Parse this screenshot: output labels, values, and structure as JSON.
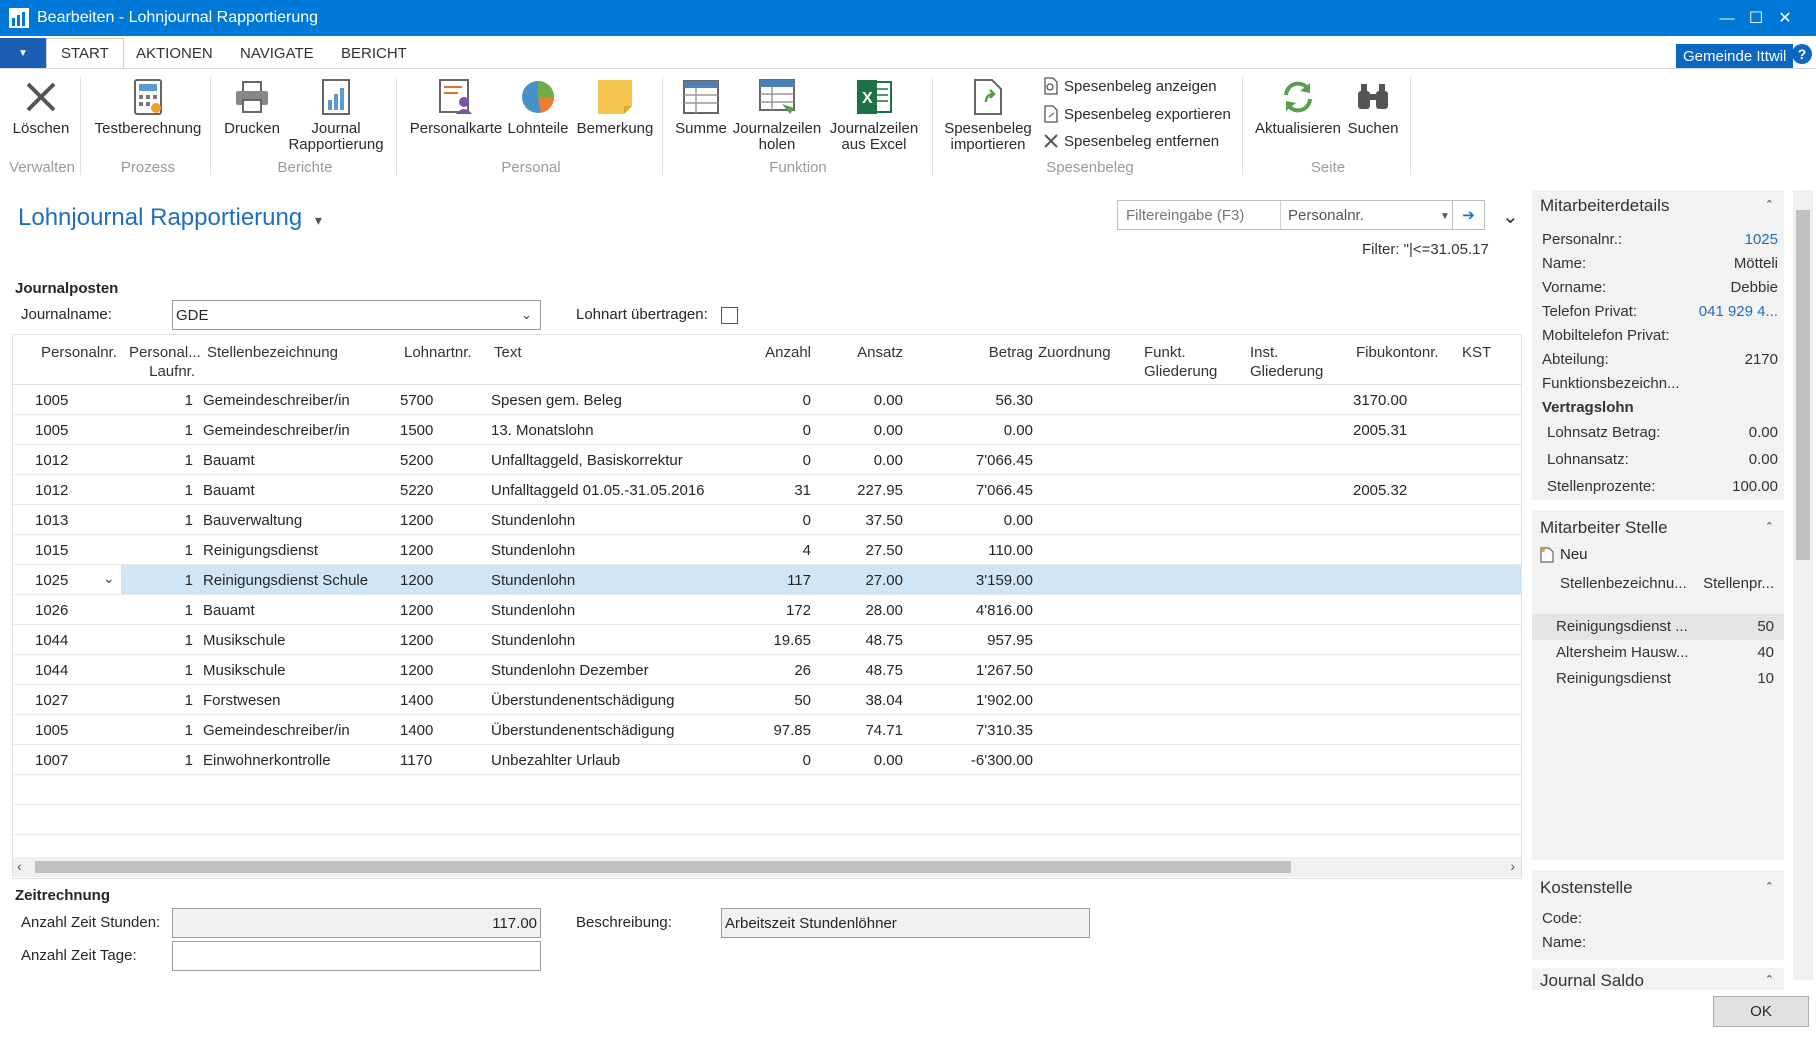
{
  "window": {
    "title": "Bearbeiten - Lohnjournal Rapportierung",
    "min": "—",
    "max": "☐",
    "close": "✕"
  },
  "ribbon_tabs": {
    "file_arrow": "▼",
    "start": "START",
    "aktionen": "AKTIONEN",
    "navigate": "NAVIGATE",
    "bericht": "BERICHT"
  },
  "company": "Gemeinde Ittwil",
  "help": "?",
  "ribbon": {
    "loeschen": "Löschen",
    "testberechnung": "Testberechnung",
    "drucken": "Drucken",
    "journal_rapportierung_1": "Journal",
    "journal_rapportierung_2": "Rapportierung",
    "personalkarte": "Personalkarte",
    "lohnteile": "Lohnteile",
    "bemerkung": "Bemerkung",
    "summe": "Summe",
    "journalzeilen_holen_1": "Journalzeilen",
    "journalzeilen_holen_2": "holen",
    "journalzeilen_excel_1": "Journalzeilen",
    "journalzeilen_excel_2": "aus Excel",
    "spesenbeleg_importieren_1": "Spesenbeleg",
    "spesenbeleg_importieren_2": "importieren",
    "spesenbeleg_anzeigen": "Spesenbeleg anzeigen",
    "spesenbeleg_exportieren": "Spesenbeleg exportieren",
    "spesenbeleg_entfernen": "Spesenbeleg entfernen",
    "aktualisieren": "Aktualisieren",
    "suchen": "Suchen",
    "groups": {
      "verwalten": "Verwalten",
      "prozess": "Prozess",
      "berichte": "Berichte",
      "personal": "Personal",
      "funktion": "Funktion",
      "spesenbeleg": "Spesenbeleg",
      "seite": "Seite"
    }
  },
  "page": {
    "title": "Lohnjournal Rapportierung",
    "title_caret": "▾",
    "collapse": "⌄"
  },
  "filter": {
    "placeholder": "Filtereingabe (F3)",
    "field": "Personalnr.",
    "dd": "▼",
    "go": "➔",
    "active": "Filter: \"|<=31.05.17"
  },
  "journal": {
    "section": "Journalposten",
    "name_label": "Journalname:",
    "name_value": "GDE",
    "name_chevron": "⌄",
    "lohnart_label": "Lohnart übertragen:"
  },
  "grid": {
    "headers": {
      "personalnr": "Personalnr.",
      "laufnr_1": "Personal...",
      "laufnr_2": "Laufnr.",
      "stelle": "Stellenbezeichnung",
      "lohnartnr": "Lohnartnr.",
      "text": "Text",
      "anzahl": "Anzahl",
      "ansatz": "Ansatz",
      "betrag": "Betrag",
      "zuordnung": "Zuordnung",
      "funkt_1": "Funkt.",
      "funkt_2": "Gliederung",
      "inst_1": "Inst.",
      "inst_2": "Gliederung",
      "fibu": "Fibukontonr.",
      "kst": "KST"
    },
    "rows": [
      {
        "pnr": "1005",
        "lfn": "1",
        "stelle": "Gemeindeschreiber/in",
        "lohnart": "5700",
        "text": "Spesen gem. Beleg",
        "anzahl": "0",
        "ansatz": "0.00",
        "betrag": "56.30",
        "fibu": "3170.00"
      },
      {
        "pnr": "1005",
        "lfn": "1",
        "stelle": "Gemeindeschreiber/in",
        "lohnart": "1500",
        "text": "13. Monatslohn",
        "anzahl": "0",
        "ansatz": "0.00",
        "betrag": "0.00",
        "fibu": "2005.31"
      },
      {
        "pnr": "1012",
        "lfn": "1",
        "stelle": "Bauamt",
        "lohnart": "5200",
        "text": "Unfalltaggeld, Basiskorrektur",
        "anzahl": "0",
        "ansatz": "0.00",
        "betrag": "7'066.45",
        "fibu": ""
      },
      {
        "pnr": "1012",
        "lfn": "1",
        "stelle": "Bauamt",
        "lohnart": "5220",
        "text": "Unfalltaggeld 01.05.-31.05.2016",
        "anzahl": "31",
        "ansatz": "227.95",
        "betrag": "7'066.45",
        "fibu": "2005.32"
      },
      {
        "pnr": "1013",
        "lfn": "1",
        "stelle": "Bauverwaltung",
        "lohnart": "1200",
        "text": "Stundenlohn",
        "anzahl": "0",
        "ansatz": "37.50",
        "betrag": "0.00",
        "fibu": ""
      },
      {
        "pnr": "1015",
        "lfn": "1",
        "stelle": "Reinigungsdienst",
        "lohnart": "1200",
        "text": "Stundenlohn",
        "anzahl": "4",
        "ansatz": "27.50",
        "betrag": "110.00",
        "fibu": ""
      },
      {
        "pnr": "1025",
        "lfn": "1",
        "stelle": "Reinigungsdienst Schule",
        "lohnart": "1200",
        "text": "Stundenlohn",
        "anzahl": "117",
        "ansatz": "27.00",
        "betrag": "3'159.00",
        "fibu": ""
      },
      {
        "pnr": "1026",
        "lfn": "1",
        "stelle": "Bauamt",
        "lohnart": "1200",
        "text": "Stundenlohn",
        "anzahl": "172",
        "ansatz": "28.00",
        "betrag": "4'816.00",
        "fibu": ""
      },
      {
        "pnr": "1044",
        "lfn": "1",
        "stelle": "Musikschule",
        "lohnart": "1200",
        "text": "Stundenlohn",
        "anzahl": "19.65",
        "ansatz": "48.75",
        "betrag": "957.95",
        "fibu": ""
      },
      {
        "pnr": "1044",
        "lfn": "1",
        "stelle": "Musikschule",
        "lohnart": "1200",
        "text": "Stundenlohn Dezember",
        "anzahl": "26",
        "ansatz": "48.75",
        "betrag": "1'267.50",
        "fibu": ""
      },
      {
        "pnr": "1027",
        "lfn": "1",
        "stelle": "Forstwesen",
        "lohnart": "1400",
        "text": "Überstundenentschädigung",
        "anzahl": "50",
        "ansatz": "38.04",
        "betrag": "1'902.00",
        "fibu": ""
      },
      {
        "pnr": "1005",
        "lfn": "1",
        "stelle": "Gemeindeschreiber/in",
        "lohnart": "1400",
        "text": "Überstundenentschädigung",
        "anzahl": "97.85",
        "ansatz": "74.71",
        "betrag": "7'310.35",
        "fibu": ""
      },
      {
        "pnr": "1007",
        "lfn": "1",
        "stelle": "Einwohnerkontrolle",
        "lohnart": "1170",
        "text": "Unbezahlter Urlaub",
        "anzahl": "0",
        "ansatz": "0.00",
        "betrag": "-6'300.00",
        "fibu": ""
      }
    ],
    "selected_chevron": "⌄",
    "scroll_left": "‹",
    "scroll_right": "›"
  },
  "zeit": {
    "section": "Zeitrechnung",
    "stunden_label": "Anzahl Zeit Stunden:",
    "stunden_value": "117.00",
    "tage_label": "Anzahl Zeit Tage:",
    "tage_value": "",
    "beschreibung_label": "Beschreibung:",
    "beschreibung_value": "Arbeitszeit Stundenlöhner"
  },
  "factbox": {
    "collapse": "⌃",
    "mitarbeiter": {
      "title": "Mitarbeiterdetails",
      "personalnr_l": "Personalnr.:",
      "personalnr": "1025",
      "name_l": "Name:",
      "name": "Mötteli",
      "vorname_l": "Vorname:",
      "vorname": "Debbie",
      "tel_l": "Telefon Privat:",
      "tel": "041 929 4...",
      "mobil_l": "Mobiltelefon Privat:",
      "abteilung_l": "Abteilung:",
      "abteilung": "2170",
      "funktion_l": "Funktionsbezeichn...",
      "vertrag": "Vertragslohn",
      "lohnsatz_l": "Lohnsatz Betrag:",
      "lohnsatz": "0.00",
      "lohnansatz_l": "Lohnansatz:",
      "lohnansatz": "0.00",
      "stellenproz_l": "Stellenprozente:",
      "stellenproz": "100.00"
    },
    "stelle": {
      "title": "Mitarbeiter Stelle",
      "neu": "Neu",
      "col1": "Stellenbezeichnu...",
      "col2": "Stellenpr...",
      "rows": [
        {
          "name": "Reinigungsdienst ...",
          "pct": "50"
        },
        {
          "name": "Altersheim Hausw...",
          "pct": "40"
        },
        {
          "name": "Reinigungsdienst",
          "pct": "10"
        }
      ]
    },
    "kosten": {
      "title": "Kostenstelle",
      "code_l": "Code:",
      "name_l": "Name:"
    },
    "saldo": {
      "title": "Journal Saldo"
    }
  },
  "ok": "OK"
}
